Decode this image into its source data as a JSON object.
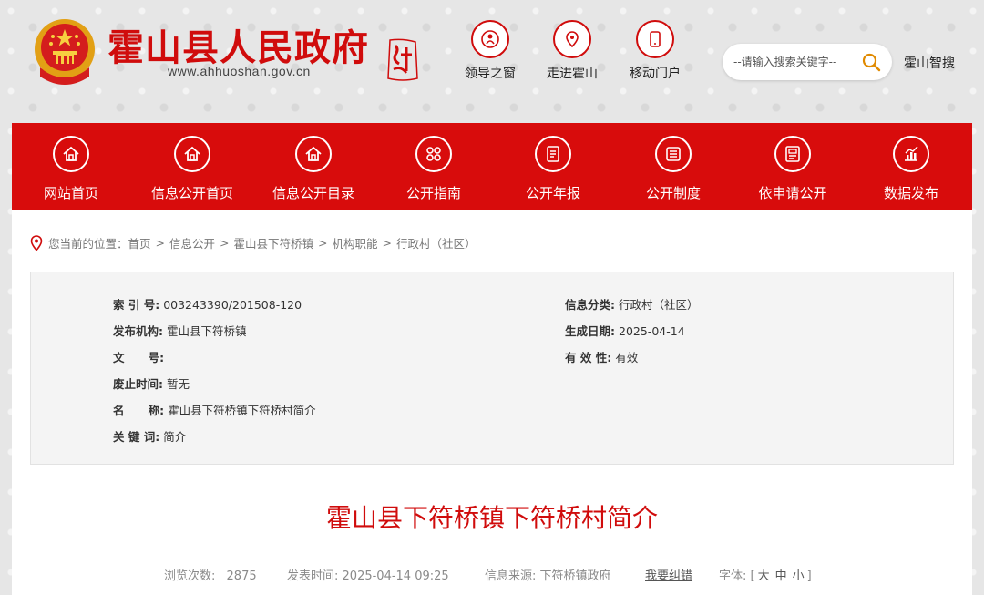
{
  "header": {
    "title": "霍山县人民政府",
    "domain": "www.ahhuoshan.gov.cn",
    "quick_links": [
      {
        "label": "领导之窗",
        "icon": "leader-icon"
      },
      {
        "label": "走进霍山",
        "icon": "location-icon"
      },
      {
        "label": "移动门户",
        "icon": "mobile-icon"
      }
    ],
    "search": {
      "placeholder": "--请输入搜索关键字--",
      "icon": "search-icon"
    },
    "smart_search": "霍山智搜"
  },
  "nav": [
    {
      "label": "网站首页",
      "icon": "home-icon"
    },
    {
      "label": "信息公开首页",
      "icon": "home-icon"
    },
    {
      "label": "信息公开目录",
      "icon": "home-icon"
    },
    {
      "label": "公开指南",
      "icon": "grid-icon"
    },
    {
      "label": "公开年报",
      "icon": "report-icon"
    },
    {
      "label": "公开制度",
      "icon": "list-icon"
    },
    {
      "label": "依申请公开",
      "icon": "form-icon"
    },
    {
      "label": "数据发布",
      "icon": "chart-icon"
    }
  ],
  "breadcrumb": {
    "prefix": "您当前的位置：",
    "items": [
      "首页",
      "信息公开",
      "霍山县下符桥镇",
      "机构职能",
      "行政村（社区）"
    ],
    "separator": ">"
  },
  "meta": {
    "index_no": {
      "label": "索 引 号:",
      "value": "003243390/201508-120"
    },
    "category": {
      "label": "信息分类:",
      "value": "行政村（社区）"
    },
    "publisher": {
      "label": "发布机构:",
      "value": "霍山县下符桥镇"
    },
    "created": {
      "label": "生成日期:",
      "value": "2025-04-14"
    },
    "doc_no": {
      "label": "文      号:",
      "value": ""
    },
    "validity": {
      "label": "有 效 性:",
      "value": "有效"
    },
    "expiry": {
      "label": "废止时间:",
      "value": "暂无"
    },
    "name": {
      "label": "名      称:",
      "value": "霍山县下符桥镇下符桥村简介"
    },
    "keywords": {
      "label": "关 键 词:",
      "value": "简介"
    }
  },
  "article": {
    "title": "霍山县下符桥镇下符桥村简介",
    "views_label": "浏览次数:",
    "views": "2875",
    "published_label": "发表时间:",
    "published": "2025-04-14 09:25",
    "source_label": "信息来源:",
    "source": "下符桥镇政府",
    "correction": "我要纠错",
    "font_label": "字体:",
    "font_open": "[",
    "font_large": "大",
    "font_medium": "中",
    "font_small": "小",
    "font_close": "]"
  },
  "colors": {
    "brand_red": "#d80c0c",
    "title_red": "#d00c0c"
  }
}
